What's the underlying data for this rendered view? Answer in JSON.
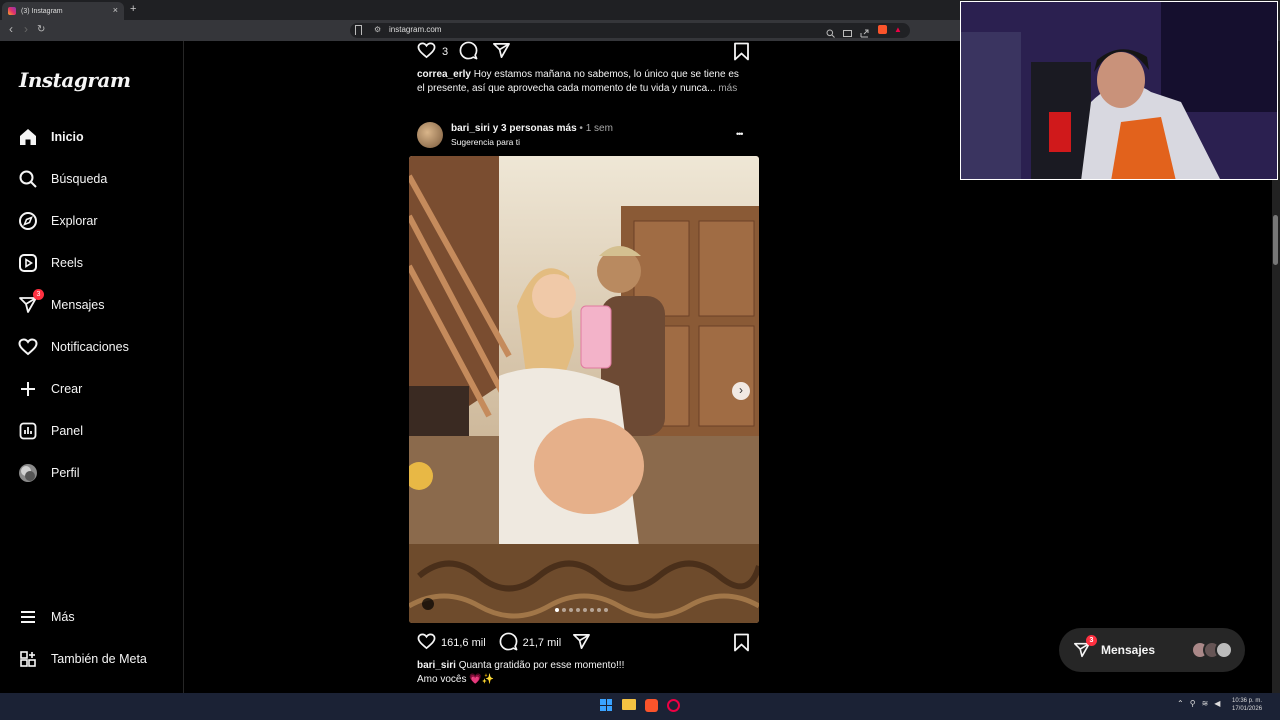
{
  "browser": {
    "tab_title": "(3) Instagram",
    "tab_close": "×",
    "new_tab": "+",
    "url": "instagram.com"
  },
  "sidebar": {
    "logo": "Instagram",
    "items": [
      {
        "label": "Inicio",
        "icon": "home-icon"
      },
      {
        "label": "Búsqueda",
        "icon": "search-icon"
      },
      {
        "label": "Explorar",
        "icon": "compass-icon"
      },
      {
        "label": "Reels",
        "icon": "reels-icon"
      },
      {
        "label": "Mensajes",
        "icon": "messenger-icon",
        "badge": "3"
      },
      {
        "label": "Notificaciones",
        "icon": "heart-icon"
      },
      {
        "label": "Crear",
        "icon": "plus-icon"
      },
      {
        "label": "Panel",
        "icon": "chart-icon"
      },
      {
        "label": "Perfil",
        "icon": "avatar"
      }
    ],
    "more": "Más",
    "meta": "También de Meta"
  },
  "prev_post": {
    "likes": "3",
    "author": "correa_erly",
    "caption_line1": "Hoy estamos mañana no sabemos, lo único que se tiene es",
    "caption_line2": "el presente, así que aprovecha cada momento de tu vida y nunca...",
    "more": "más"
  },
  "post": {
    "author": "bari_siri",
    "coauthors": "y 3 personas más",
    "time": "• 1 sem",
    "subtitle": "Sugerencia para ti",
    "more_menu": "•••",
    "likes": "161,6 mil",
    "comments": "21,7 mil",
    "caption_author": "bari_siri",
    "caption_line1": "Quanta gratidão por esse momento!!!",
    "caption_line2": "Amo vocês 💗✨",
    "carousel_count": 8
  },
  "messages_pill": {
    "label": "Mensajes",
    "badge": "3"
  },
  "taskbar": {
    "time": "10:36 p. m.",
    "date": "17/01/2026"
  },
  "colors": {
    "badge": "#ff3040",
    "background": "#000000"
  }
}
